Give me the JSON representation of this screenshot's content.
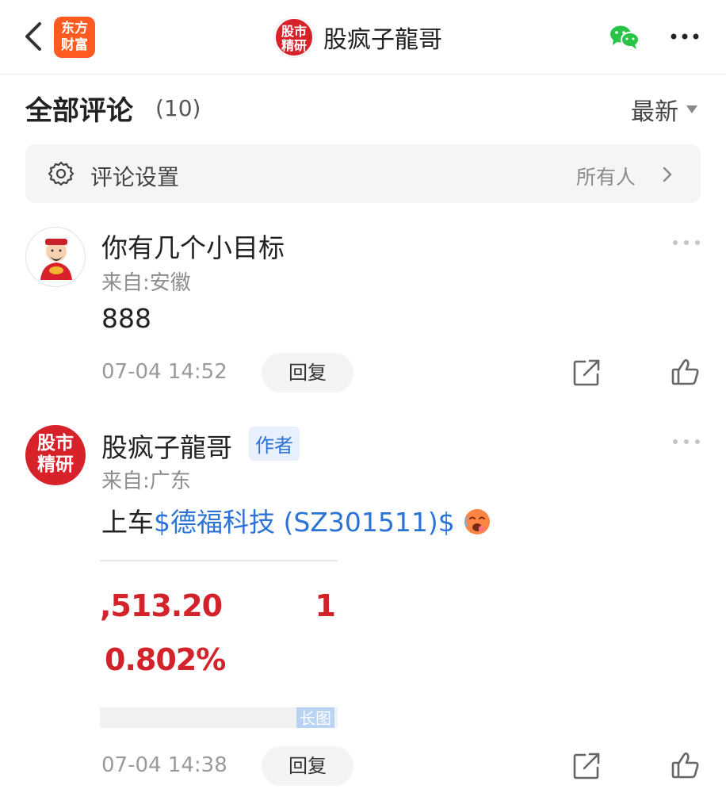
{
  "app": {
    "logo_line1": "东方",
    "logo_line2": "财富",
    "brand_color": "#ff5a1f"
  },
  "header": {
    "avatar_line1": "股市",
    "avatar_line2": "精研",
    "title": "股疯子龍哥"
  },
  "comments_section": {
    "title": "全部评论",
    "count": "(10)",
    "sort_label": "最新"
  },
  "settings": {
    "label": "评论设置",
    "value": "所有人"
  },
  "comments": [
    {
      "username": "你有几个小目标",
      "region": "来自:安徽",
      "text": "888",
      "time": "07-04 14:52",
      "reply_label": "回复"
    },
    {
      "username": "股疯子龍哥",
      "avatar_line1": "股市",
      "avatar_line2": "精研",
      "author_badge": "作者",
      "region": "来自:广东",
      "text_prefix": "上车",
      "stock_link": "$德福科技 (SZ301511)$",
      "emoji": "hot-face-emoji",
      "attachment": {
        "price": ",513.20",
        "price_right": "1",
        "percent": "0.802%",
        "tag": "长图"
      },
      "time": "07-04 14:38",
      "reply_label": "回复"
    }
  ],
  "colors": {
    "link": "#2b73d6",
    "up_red": "#d2232a",
    "brand_red": "#d8222a"
  }
}
